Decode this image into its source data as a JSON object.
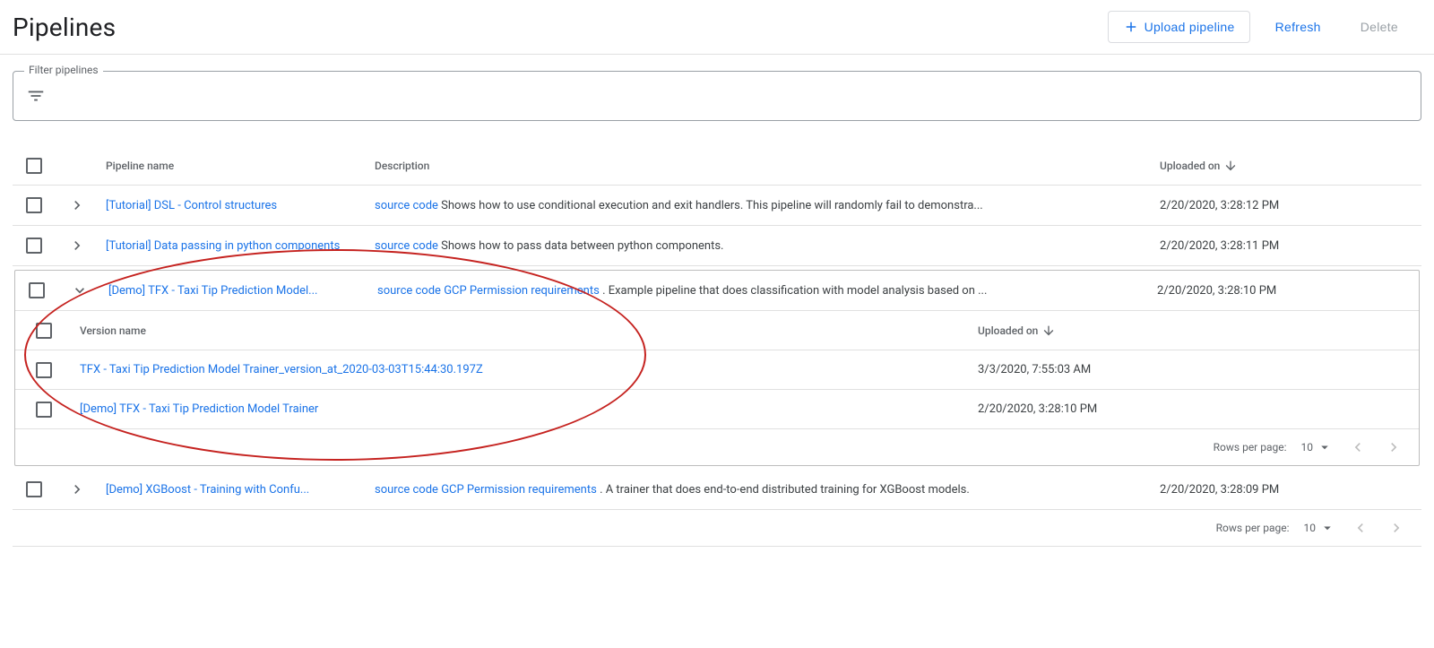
{
  "header": {
    "title": "Pipelines",
    "upload_label": "Upload pipeline",
    "refresh_label": "Refresh",
    "delete_label": "Delete"
  },
  "filter": {
    "label": "Filter pipelines",
    "value": ""
  },
  "columns": {
    "name": "Pipeline name",
    "description": "Description",
    "uploaded": "Uploaded on"
  },
  "rows": [
    {
      "name": "[Tutorial] DSL - Control structures",
      "link": "source code",
      "desc": " Shows how to use conditional execution and exit handlers. This pipeline will randomly fail to demonstra...",
      "ts": "2/20/2020, 3:28:12 PM"
    },
    {
      "name": "[Tutorial] Data passing in python components",
      "link": "source code",
      "desc": " Shows how to pass data between python components.",
      "ts": "2/20/2020, 3:28:11 PM"
    },
    {
      "name": "[Demo] TFX - Taxi Tip Prediction Model...",
      "link": "source code",
      "link2": "GCP Permission requirements",
      "desc": ". Example pipeline that does classification with model analysis based on ...",
      "ts": "2/20/2020, 3:28:10 PM"
    },
    {
      "name": "[Demo] XGBoost - Training with Confu...",
      "link": "source code",
      "link2": "GCP Permission requirements",
      "desc": ". A trainer that does end-to-end distributed training for XGBoost models.",
      "ts": "2/20/2020, 3:28:09 PM"
    }
  ],
  "inner_columns": {
    "name": "Version name",
    "uploaded": "Uploaded on"
  },
  "versions": [
    {
      "name": "TFX - Taxi Tip Prediction Model Trainer_version_at_2020-03-03T15:44:30.197Z",
      "ts": "3/3/2020, 7:55:03 AM"
    },
    {
      "name": "[Demo] TFX - Taxi Tip Prediction Model Trainer",
      "ts": "2/20/2020, 3:28:10 PM"
    }
  ],
  "pagination": {
    "label": "Rows per page:",
    "value": "10"
  }
}
